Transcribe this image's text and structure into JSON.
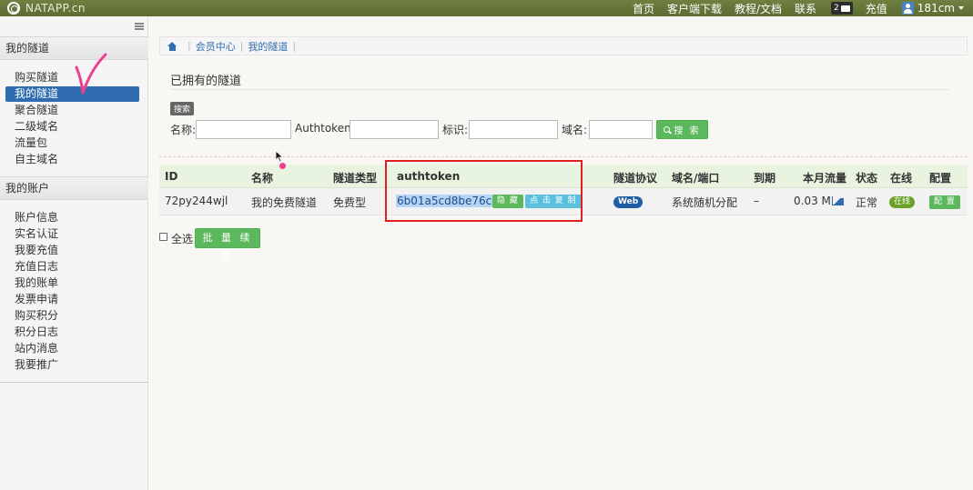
{
  "navbar": {
    "brand": "NATAPP.cn",
    "links": [
      "首页",
      "客户端下载",
      "教程/文档",
      "联系"
    ],
    "message_count": "2",
    "recharge": "充值",
    "user": "181cm"
  },
  "sidebar": {
    "section1": "我的隧道",
    "section1_items": [
      "购买隧道",
      "我的隧道",
      "聚合隧道",
      "二级域名",
      "流量包",
      "自主域名"
    ],
    "active_item": "我的隧道",
    "section2": "我的账户",
    "section2_items": [
      "账户信息",
      "实名认证",
      "我要充值",
      "充值日志",
      "我的账单",
      "发票申请",
      "购买积分",
      "积分日志",
      "站内消息",
      "我要推广"
    ]
  },
  "breadcrumb": [
    "会员中心",
    "我的隧道"
  ],
  "page_title": "已拥有的隧道",
  "search": {
    "tag": "搜索",
    "name_label": "名称:",
    "authtoken_label": "Authtoken:",
    "id_label": "标识:",
    "domain_label": "域名:",
    "button": "搜 索"
  },
  "table": {
    "headers": [
      "ID",
      "名称",
      "隧道类型",
      "authtoken",
      "隧道协议",
      "域名/端口",
      "到期",
      "本月流量",
      "状态",
      "在线",
      "配置"
    ],
    "rows": [
      {
        "id": "72py244wjl",
        "name": "我的免费隧道",
        "type": "免费型",
        "authtoken": "6b01a5cd8be76c7d",
        "hide_btn": "隐 藏",
        "copy_btn": "点 击 复 制",
        "protocol": "Web",
        "domain": "系统随机分配",
        "expire": "–",
        "traffic": "0.03 M",
        "status": "正常",
        "online": "在线",
        "config": "配 置"
      }
    ]
  },
  "footer": {
    "select_all": "全选",
    "batch_renew": "批 量 续 费"
  },
  "colors": {
    "navbar": "#5c6c33",
    "active": "#2f6db0",
    "success": "#5cb85c",
    "highlight": "#e02020"
  }
}
